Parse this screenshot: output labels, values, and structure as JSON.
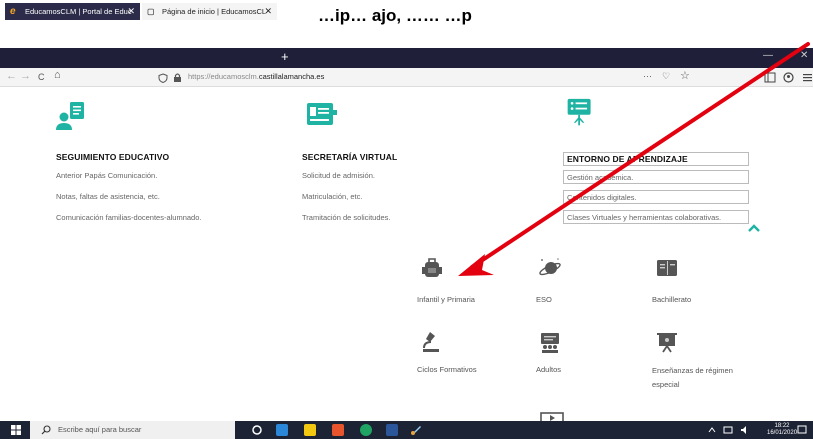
{
  "caption": "…ip… ajo, …… …p",
  "browser": {
    "tabs": [
      {
        "label": "EducamosCLM | Portal de Educ",
        "close": "✕",
        "icon": "e"
      },
      {
        "label": "Página de inicio | EducamosCL",
        "close": "✕",
        "icon": "▢"
      }
    ],
    "new_tab": "+",
    "minimize": "—",
    "close_window": "✕",
    "nav": {
      "back": "←",
      "forward": "→",
      "reload": "C",
      "home": "⌂"
    },
    "url_prefix": "https://educamosclm.",
    "url_domain": "castillalamancha.es",
    "url_more": "···",
    "bookmark": "☆",
    "pocket": "♡"
  },
  "columns": [
    {
      "title": "SEGUIMIENTO EDUCATIVO",
      "icon": "student-report-icon",
      "links": [
        "Anterior Papás Comunicación.",
        "Notas, faltas de asistencia, etc.",
        "Comunicación familias-docentes-alumnado."
      ]
    },
    {
      "title": "SECRETARÍA VIRTUAL",
      "icon": "secretary-screen-icon",
      "links": [
        "Solicitud de admisión.",
        "Matriculación, etc.",
        "Tramitación de solicitudes."
      ]
    },
    {
      "title": "ENTORNO DE APRENDIZAJE",
      "icon": "learning-board-icon",
      "links": [
        "Gestión académica.",
        "Contenidos digitales.",
        "Clases Virtuales y herramientas colaborativas."
      ]
    }
  ],
  "grid": [
    {
      "label": "Infantil y Primaria",
      "icon": "backpack-icon"
    },
    {
      "label": "ESO",
      "icon": "planet-icon"
    },
    {
      "label": "Bachillerato",
      "icon": "book-icon"
    },
    {
      "label": "Ciclos Formativos",
      "icon": "microscope-icon"
    },
    {
      "label": "Adultos",
      "icon": "adults-icon"
    },
    {
      "label": "Enseñanzas de régimen especial",
      "icon": "presentation-icon"
    }
  ],
  "taskbar": {
    "search_placeholder": "Escribe aquí para buscar",
    "time": "18:22",
    "date": "16/01/2020"
  },
  "colors": {
    "accent": "#1fb3a3",
    "annotation": "#e3000f",
    "tabbar": "#1f1f3a",
    "taskbar": "#1c2335"
  }
}
